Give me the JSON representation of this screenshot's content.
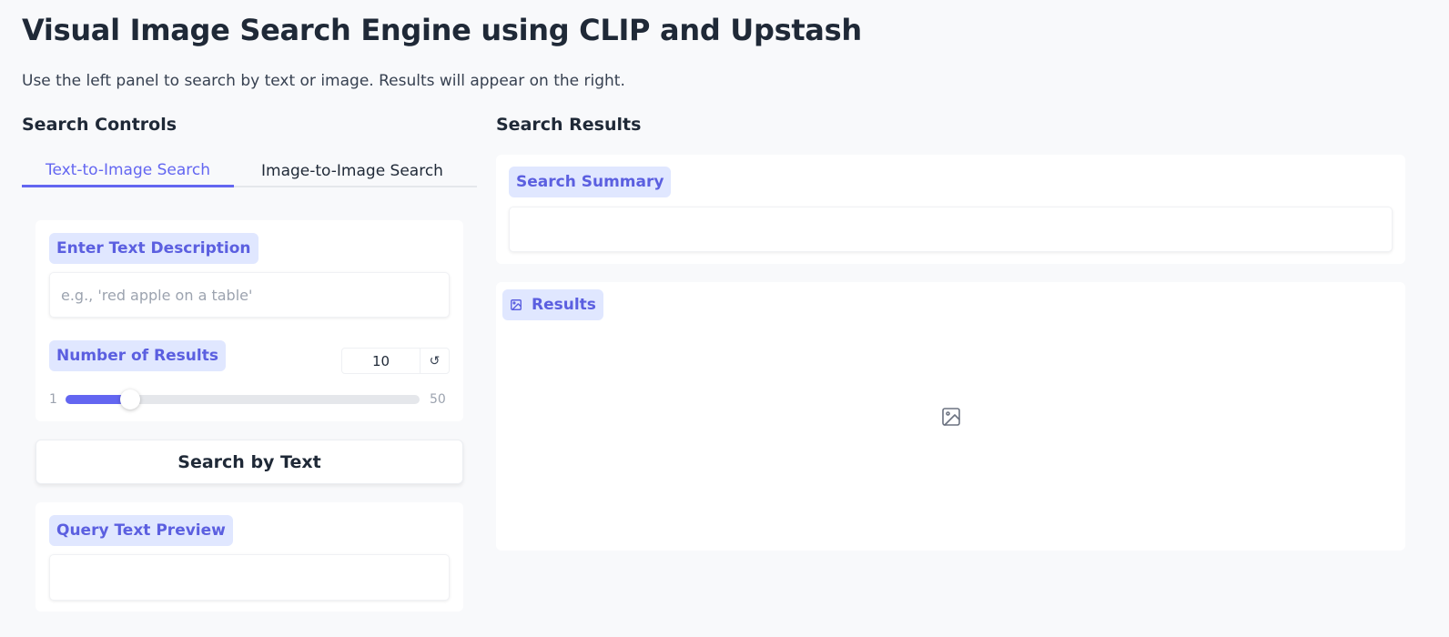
{
  "header": {
    "title": "Visual Image Search Engine using CLIP and Upstash",
    "subtitle": "Use the left panel to search by text or image. Results will appear on the right."
  },
  "left_panel": {
    "title": "Search Controls",
    "tabs": [
      {
        "label": "Text-to-Image Search",
        "active": true
      },
      {
        "label": "Image-to-Image Search",
        "active": false
      }
    ],
    "text_input": {
      "label": "Enter Text Description",
      "placeholder": "e.g., 'red apple on a table'",
      "value": ""
    },
    "num_results": {
      "label": "Number of Results",
      "value": "10",
      "min": "1",
      "max": "50",
      "fraction": 0.1837
    },
    "search_button": "Search by Text",
    "query_preview": {
      "label": "Query Text Preview",
      "value": ""
    }
  },
  "right_panel": {
    "title": "Search Results",
    "summary": {
      "label": "Search Summary",
      "value": ""
    },
    "results": {
      "label": "Results"
    }
  },
  "colors": {
    "accent": "#6366f1",
    "badge_bg": "#e0e7ff",
    "background": "#f8f9fb"
  },
  "icons": {
    "reset": "reset-icon",
    "image": "image-icon"
  }
}
